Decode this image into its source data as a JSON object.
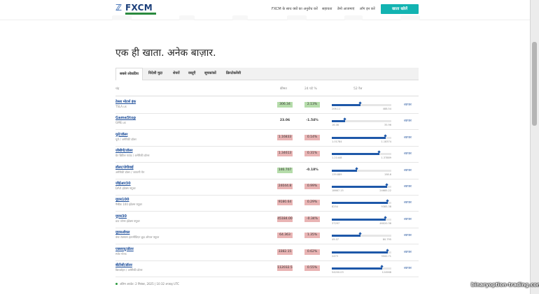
{
  "header": {
    "logo_text": "FXCM",
    "nav": [
      "FXCM के साथ क्यों का अनुरोध करें",
      "सहायता",
      "डेमो आजमाएं",
      "लॉग इन करें"
    ],
    "cta": "खाता खोलें"
  },
  "headline": "एक ही खाता. अनेक बाज़ार.",
  "tabs": [
    {
      "label": "सबसे लोकप्रिय",
      "active": true
    },
    {
      "label": "विदेशी मुद्रा",
      "active": false
    },
    {
      "label": "शेयरों",
      "active": false
    },
    {
      "label": "वस्तुएँ",
      "active": false
    },
    {
      "label": "सूचकांकों",
      "active": false
    },
    {
      "label": "क्रिप्टोकरेंसी",
      "active": false
    }
  ],
  "table": {
    "columns": [
      "चंद्र",
      "कीमत",
      "24 घंटे %",
      "52 रेंज"
    ],
    "trade_label": "व्यापार",
    "rows": [
      {
        "name": "टेस्ला मोटर्स इंक",
        "sub": "TSLA.us",
        "price": "306.34",
        "change": "2.13%",
        "trend": "pos",
        "low": "206.11",
        "high": "488.54",
        "pos": 0.48
      },
      {
        "name": "GameStop",
        "sub": "GME.us",
        "price": "23.06",
        "change": "-1.54%",
        "trend": "plain",
        "low": "16.08",
        "high": "35.96",
        "pos": 0.22
      },
      {
        "name": "यूरो/डॉलर",
        "sub": "यूरो / अमेरिकी डॉलर",
        "price": "1.16833",
        "change": "0.14%",
        "trend": "neg",
        "low": "1.01784",
        "high": "1.18374",
        "pos": 0.9
      },
      {
        "name": "जीबीपी/डॉलर",
        "sub": "ग्रेट ब्रिटिश पाउंड / अमेरिकी डॉलर",
        "price": "1.34613",
        "change": "0.31%",
        "trend": "neg",
        "low": "1.21448",
        "high": "1.37889",
        "pos": 0.8
      },
      {
        "name": "डॉलर/जेपीवाई",
        "sub": "अमेरिकी डॉलर / जापानी येन",
        "price": "146.707",
        "change": "-0.18%",
        "trend": "pos",
        "low": "139.889",
        "high": "158.6",
        "pos": 0.42
      },
      {
        "name": "जीईआर30",
        "sub": "DAX इंडेक्स फ्यूचर",
        "price": "24044.8",
        "change": "0.99%",
        "trend": "neg",
        "low": "18667.15",
        "high": "24685.22",
        "pos": 0.93
      },
      {
        "name": "यूएस100",
        "sub": "नैस्डैक 100 इंडेक्स फ्यूचर",
        "price": "9180.64",
        "change": "0.29%",
        "trend": "neg",
        "low": "8254",
        "high": "9385.38",
        "pos": 0.94
      },
      {
        "name": "यूएस30",
        "sub": "डाउ जोन्स इंडेक्स फ्यूचर",
        "price": "45184.00",
        "change": "-0.34%",
        "trend": "neg",
        "low": "37297",
        "high": "46020.36",
        "pos": 0.9
      },
      {
        "name": "यूएसऑयल",
        "sub": "वेस्ट टेक्सास इंटरमीडिएट क्रूड ऑयल फ्यूचर",
        "price": "64.363",
        "change": "1.35%",
        "trend": "neg",
        "low": "49.07",
        "high": "80.795",
        "pos": 0.48
      },
      {
        "name": "एक्सएयू/डॉलर",
        "sub": "स्पॉट गोल्ड",
        "price": "3382.15",
        "change": "0.62%",
        "trend": "neg",
        "low": "2473",
        "high": "3500.71",
        "pos": 0.94
      },
      {
        "name": "बीटीसी/डॉलर",
        "sub": "बिटकॉइन / अमेरिकी डॉलर",
        "price": "112032.5",
        "change": "0.55%",
        "trend": "neg",
        "low": "54200.03",
        "high": "124568",
        "pos": 0.85
      }
    ]
  },
  "footnote": "अंतिम अपडेट: 2 सितंबर, 2025 | 10:32 अपराह्न UTC",
  "watermark": "binaryoption-trading.com",
  "colors": {
    "accent": "#12b3b1",
    "brand": "#1c3f7a",
    "bar": "#1e58a9",
    "neg": "#e9b4b4",
    "pos": "#b5dcaa"
  }
}
